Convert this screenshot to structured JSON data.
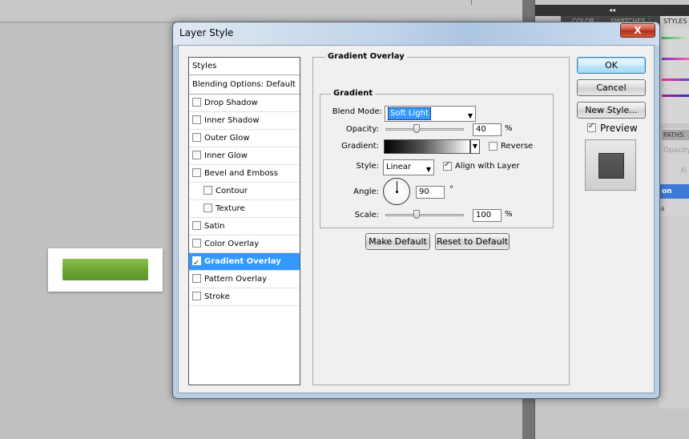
{
  "dialog": {
    "title": "Layer Style",
    "close_label": "X"
  },
  "styles_list": {
    "items": [
      {
        "label": "Styles",
        "type": "header"
      },
      {
        "label": "Blending Options: Default",
        "type": "header"
      },
      {
        "label": "Drop Shadow",
        "checked": false
      },
      {
        "label": "Inner Shadow",
        "checked": false
      },
      {
        "label": "Outer Glow",
        "checked": false
      },
      {
        "label": "Inner Glow",
        "checked": false
      },
      {
        "label": "Bevel and Emboss",
        "checked": false
      },
      {
        "label": "Contour",
        "checked": false,
        "sub": true
      },
      {
        "label": "Texture",
        "checked": false,
        "sub": true
      },
      {
        "label": "Satin",
        "checked": false
      },
      {
        "label": "Color Overlay",
        "checked": false
      },
      {
        "label": "Gradient Overlay",
        "checked": true,
        "selected": true
      },
      {
        "label": "Pattern Overlay",
        "checked": false
      },
      {
        "label": "Stroke",
        "checked": false
      }
    ]
  },
  "gradient_overlay": {
    "section_title": "Gradient Overlay",
    "group_title": "Gradient",
    "blend_mode_label": "Blend Mode:",
    "blend_mode_value": "Soft Light",
    "opacity_label": "Opacity:",
    "opacity_value": "40",
    "opacity_unit": "%",
    "opacity_fraction": 0.4,
    "gradient_label": "Gradient:",
    "reverse_label": "Reverse",
    "reverse_checked": false,
    "style_label": "Style:",
    "style_value": "Linear",
    "align_label": "Align with Layer",
    "align_checked": true,
    "angle_label": "Angle:",
    "angle_value": "90",
    "angle_unit": "°",
    "scale_label": "Scale:",
    "scale_value": "100",
    "scale_unit": "%",
    "scale_fraction": 0.4,
    "make_default_label": "Make Default",
    "reset_default_label": "Reset to Default"
  },
  "actions": {
    "ok_label": "OK",
    "cancel_label": "Cancel",
    "new_style_label": "New Style...",
    "preview_label": "Preview",
    "preview_checked": true
  },
  "right_panel": {
    "header_label": "◂◂",
    "tabs": [
      "COLOR",
      "SWATCHES",
      "STYLES"
    ],
    "tab2_label": "PATHS",
    "opacity_text": "Opacity",
    "fill_text": "Fi",
    "selected_layer_text": "on",
    "misc_text": "a"
  },
  "colors": {
    "accent": "#3399ff",
    "green_button": "#6aa433"
  }
}
